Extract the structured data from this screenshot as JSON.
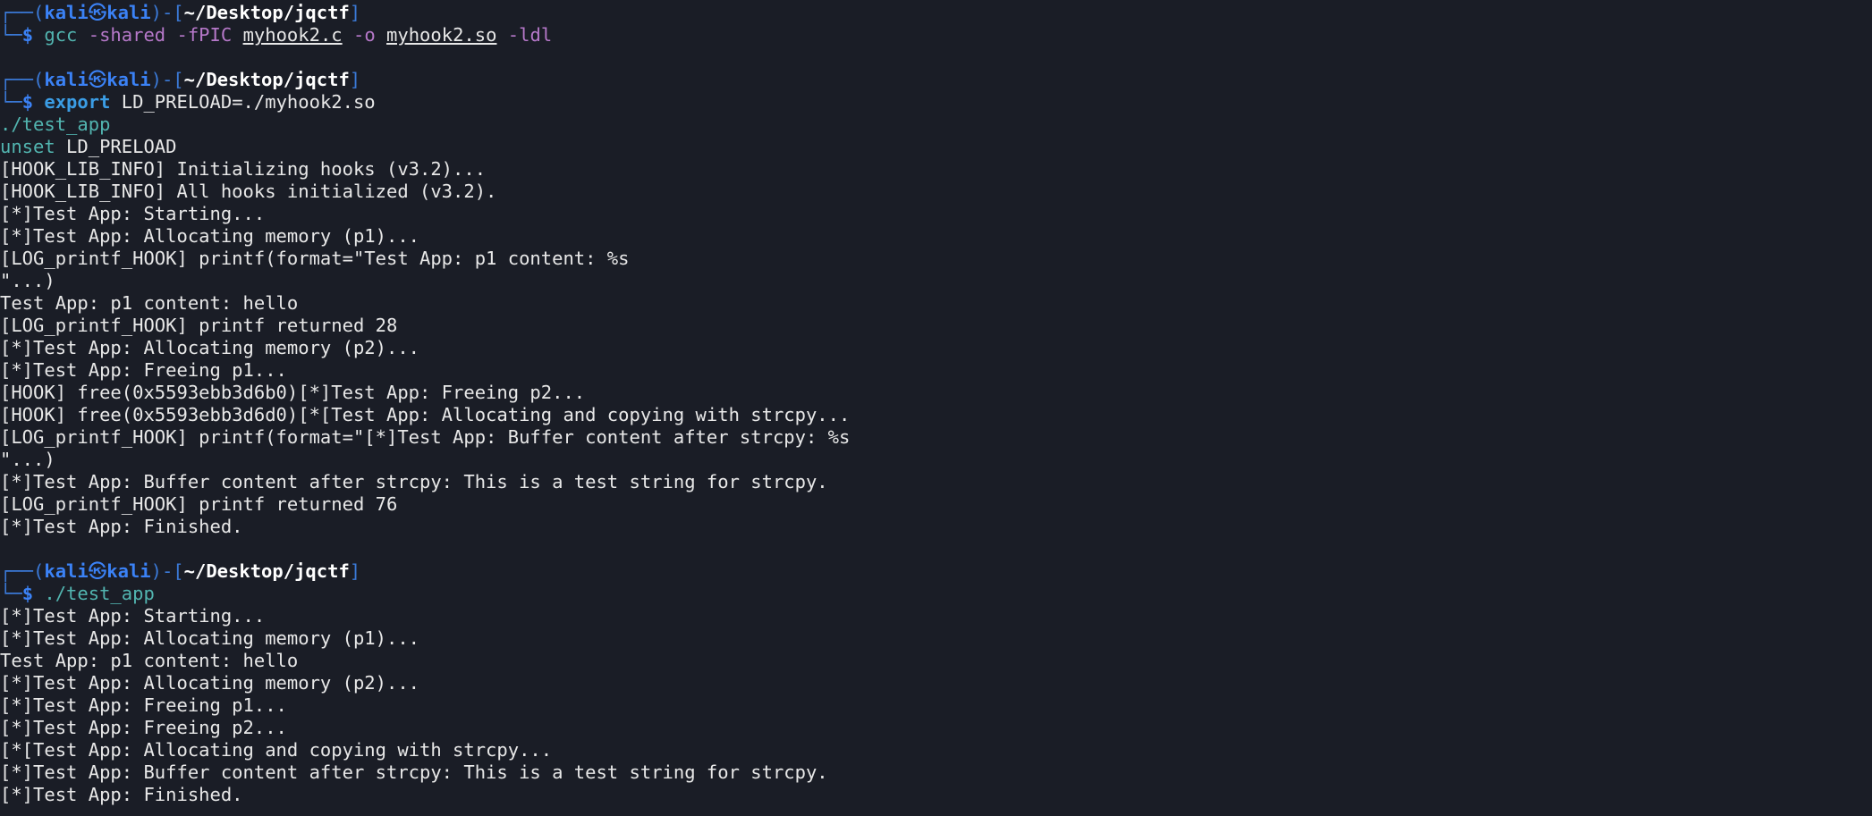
{
  "prompt": {
    "box_top": "┌──(",
    "user": "kali",
    "at_symbol": "㉿",
    "host": "kali",
    "mid": ")-[",
    "path": "~/Desktop/jqctf",
    "close": "]",
    "box_bottom": "└─",
    "dollar": "$"
  },
  "block1": {
    "cmd": "gcc",
    "opt1": "-shared",
    "opt2": "-fPIC",
    "src": "myhook2.c",
    "opt3": "-o",
    "out": "myhook2.so",
    "opt4": "-ldl"
  },
  "block2": {
    "kw": "export",
    "rest": "LD_PRELOAD=./myhook2.so",
    "line2": "./test_app",
    "line3_kw": "unset",
    "line3_rest": " LD_PRELOAD",
    "output": [
      "[HOOK_LIB_INFO] Initializing hooks (v3.2)...",
      "[HOOK_LIB_INFO] All hooks initialized (v3.2).",
      "[*]Test App: Starting...",
      "[*]Test App: Allocating memory (p1)...",
      "[LOG_printf_HOOK] printf(format=\"Test App: p1 content: %s",
      "\"...)",
      "Test App: p1 content: hello",
      "[LOG_printf_HOOK] printf returned 28",
      "[*]Test App: Allocating memory (p2)...",
      "[*]Test App: Freeing p1...",
      "[HOOK] free(0x5593ebb3d6b0)[*]Test App: Freeing p2...",
      "[HOOK] free(0x5593ebb3d6d0)[*[Test App: Allocating and copying with strcpy...",
      "[LOG_printf_HOOK] printf(format=\"[*]Test App: Buffer content after strcpy: %s",
      "\"...)",
      "[*]Test App: Buffer content after strcpy: This is a test string for strcpy.",
      "[LOG_printf_HOOK] printf returned 76",
      "[*]Test App: Finished."
    ]
  },
  "block3": {
    "cmd": "./test_app",
    "output": [
      "[*]Test App: Starting...",
      "[*]Test App: Allocating memory (p1)...",
      "Test App: p1 content: hello",
      "[*]Test App: Allocating memory (p2)...",
      "[*]Test App: Freeing p1...",
      "[*]Test App: Freeing p2...",
      "[*[Test App: Allocating and copying with strcpy...",
      "[*]Test App: Buffer content after strcpy: This is a test string for strcpy.",
      "[*]Test App: Finished."
    ]
  },
  "colors": {
    "background": "#1a1d26",
    "prompt_blue": "#3b82f6",
    "command_teal": "#52b5b0",
    "option_purple": "#b678c9",
    "keyword_blue": "#3b9de5",
    "text": "#e8e8e8"
  }
}
